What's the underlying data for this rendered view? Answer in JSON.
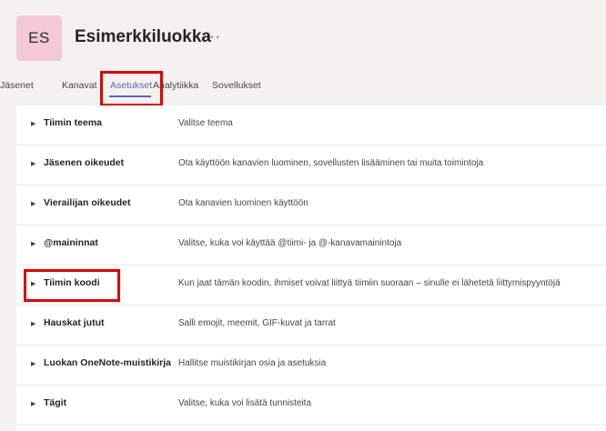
{
  "team": {
    "avatar_initials": "ES",
    "name": "Esimerkkiluokka",
    "more_label": "···"
  },
  "tabs": [
    {
      "label": "Jäsenet"
    },
    {
      "label": "Kanavat"
    },
    {
      "label": "Asetukset"
    },
    {
      "label": "Analytiikka"
    },
    {
      "label": "Sovellukset"
    }
  ],
  "settings": [
    {
      "name": "Tiimin teema",
      "description": "Valitse teema"
    },
    {
      "name": "Jäsenen oikeudet",
      "description": "Ota käyttöön kanavien luominen, sovellusten lisääminen tai muita toimintoja"
    },
    {
      "name": "Vierailijan oikeudet",
      "description": "Ota kanavien luominen käyttöön"
    },
    {
      "name": "@maininnat",
      "description": "Valitse, kuka voi käyttää @tiimi- ja @-kanavamainintoja"
    },
    {
      "name": "Tiimin koodi",
      "description": "Kun jaat tämän koodin, ihmiset voivat liittyä tiimiin suoraan – sinulle ei lähetetä liittymispyyntöjä"
    },
    {
      "name": "Hauskat jutut",
      "description": "Salli emojit, meemit, GIF-kuvat ja tarrat"
    },
    {
      "name": "Luokan OneNote-muistikirja",
      "description": "Hallitse muistikirjan osia ja asetuksia"
    },
    {
      "name": "Tägit",
      "description": "Valitse, kuka voi lisätä tunnisteita"
    }
  ],
  "colors": {
    "accent": "#6264a7",
    "highlight_box": "#e00000",
    "avatar_bg": "#f4c9d7"
  }
}
